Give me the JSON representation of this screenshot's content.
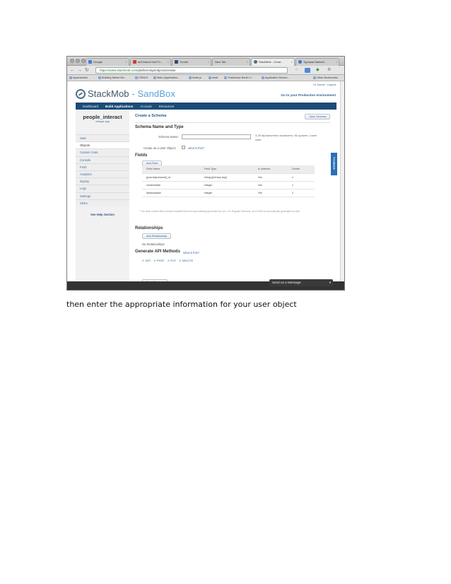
{
  "browser": {
    "tabs": [
      {
        "label": "Google"
      },
      {
        "label": "adTimeout Not Fo..."
      },
      {
        "label": "Tumblr"
      },
      {
        "label": "New Tab"
      },
      {
        "label": "StackMob - Creat..."
      },
      {
        "label": "Typepad Marketi..."
      }
    ],
    "url_host": "https://www.stackmob.com",
    "url_path": "/platform/api/objects/create",
    "bookmarks": [
      "Apps/stories",
      "Building Native Mo...",
      "CRMLS",
      "Main (Application...",
      "Node.js",
      "what",
      "Tradeshow Booth 'n...",
      "Application Develo..."
    ],
    "bookmarks_other": "Other Bookmarks"
  },
  "site": {
    "user_greeting": "Hi, Aaron!",
    "logout": "Logout",
    "logo_main": "StackMob",
    "logo_sep": " - ",
    "logo_sandbox": "SandBox",
    "production_link": "Go to your Production environment",
    "menu": [
      "Dashboard",
      "Build Applications",
      "Account",
      "Resources"
    ],
    "app_name": "people_interact",
    "change_app": "change app",
    "sidenav": [
      "Start",
      "Objects",
      "Custom Code",
      "Console",
      "Push",
      "Analytics",
      "Deploy",
      "Logs",
      "Settings",
      "SDKs"
    ],
    "help_link": "See Help Section",
    "feedback": "Feedback",
    "send_message": "Send us a Message"
  },
  "form": {
    "title": "Create a Schema",
    "save_top": "Save Schema",
    "schema_heading": "Schema Name and Type",
    "schema_name_label": "Schema Name:",
    "schema_hint": "3-25 alphanumeric characters. No spaces. Lower case.",
    "user_object_label": "Create as a User Object:",
    "what_is_this": "what is this?",
    "fields_heading": "Fields",
    "add_field": "Add Field",
    "columns": [
      "Field Name",
      "Field Type",
      "Is Indexed",
      "Delete"
    ],
    "rows": [
      [
        "[yourobjectname]_id",
        "string [primary key]",
        "Yes",
        "x"
      ],
      [
        "createddate",
        "integer",
        "Yes",
        "x"
      ],
      [
        "lastmoddate",
        "integer",
        "Yes",
        "x"
      ]
    ],
    "fields_note": "* The date created field and last modified field are automatically generated for you. For Regular Schemas, an ID field is automatically generated as well.",
    "relationships_heading": "Relationships",
    "add_relationship": "Add Relationship",
    "no_relationships": "No Relationships",
    "api_heading": "Generate API Methods",
    "api_what": "what is this?",
    "methods": [
      "GET",
      "POST",
      "PUT",
      "DELETE"
    ],
    "save_bottom": "Save Schema"
  },
  "caption": "then enter the appropriate information for your user object"
}
